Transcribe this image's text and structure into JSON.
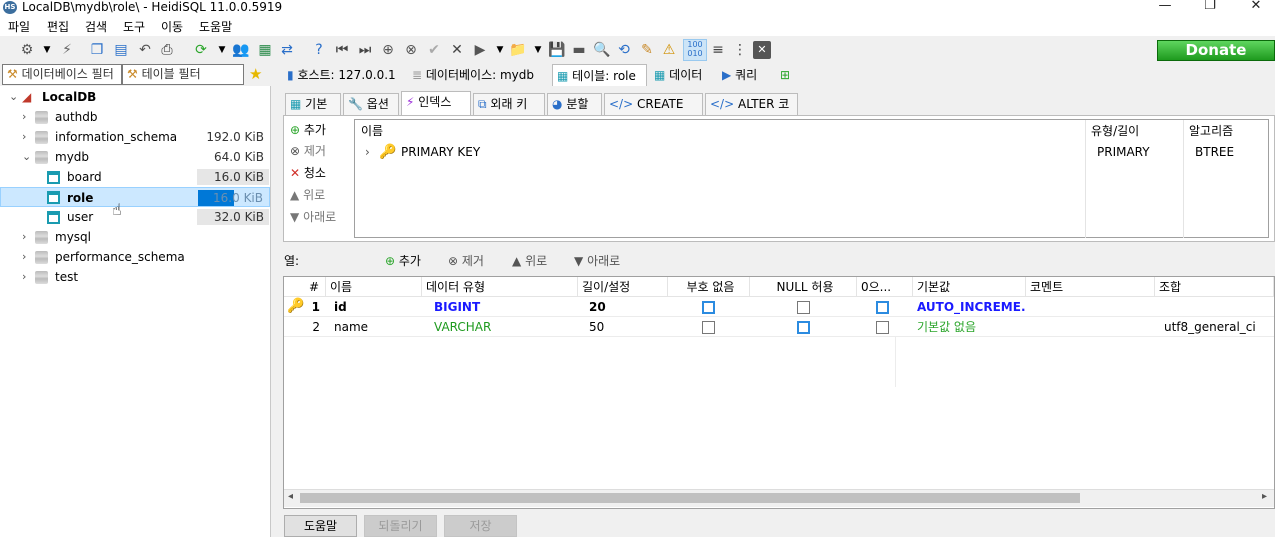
{
  "window": {
    "title": "LocalDB\\mydb\\role\\ - HeidiSQL 11.0.0.5919",
    "app_icon_text": "HS"
  },
  "menu": [
    "파일",
    "편집",
    "검색",
    "도구",
    "이동",
    "도움말"
  ],
  "donate_label": "Donate",
  "filters": {
    "db_filter": "데이터베이스 필터",
    "table_filter": "테이블 필터"
  },
  "tree": {
    "root": "LocalDB",
    "databases": [
      {
        "name": "authdb",
        "size": ""
      },
      {
        "name": "information_schema",
        "size": "192.0 KiB"
      },
      {
        "name": "mydb",
        "size": "64.0 KiB"
      },
      {
        "name": "mysql",
        "size": ""
      },
      {
        "name": "performance_schema",
        "size": ""
      },
      {
        "name": "test",
        "size": ""
      }
    ],
    "tables": [
      {
        "name": "board",
        "size": "16.0 KiB"
      },
      {
        "name": "role",
        "size": "16.0 KiB"
      },
      {
        "name": "user",
        "size": "32.0 KiB"
      }
    ]
  },
  "host_tabs": {
    "host": "호스트: 127.0.0.1",
    "database": "데이터베이스: mydb",
    "table": "테이블: role",
    "data": "데이터",
    "query": "쿼리"
  },
  "editor_tabs": [
    "기본",
    "옵션",
    "인덱스",
    "외래 키",
    "분할",
    "CREATE 코드",
    "ALTER 코드"
  ],
  "index_buttons": {
    "add": "추가",
    "remove": "제거",
    "clear": "청소",
    "up": "위로",
    "down": "아래로"
  },
  "index_list": {
    "headers": {
      "name": "이름",
      "type": "유형/길이",
      "algo": "알고리즘"
    },
    "rows": [
      {
        "name": "PRIMARY KEY",
        "type": "PRIMARY",
        "algo": "BTREE"
      }
    ]
  },
  "columns_toolbar": {
    "label": "열:",
    "add": "추가",
    "remove": "제거",
    "up": "위로",
    "down": "아래로"
  },
  "grid": {
    "headers": [
      "#",
      "이름",
      "데이터 유형",
      "길이/설정",
      "부호 없음",
      "NULL 허용",
      "0으...",
      "기본값",
      "코멘트",
      "조합"
    ],
    "rows": [
      {
        "num": "1",
        "name": "id",
        "type": "BIGINT",
        "length": "20",
        "unsigned": true,
        "nullable": false,
        "zerofill": true,
        "default": "AUTO_INCREME...",
        "comment": "",
        "collation": ""
      },
      {
        "num": "2",
        "name": "name",
        "type": "VARCHAR",
        "length": "50",
        "unsigned": false,
        "nullable": true,
        "zerofill": false,
        "default": "기본값 없음",
        "comment": "",
        "collation": "utf8_general_ci"
      }
    ]
  },
  "bottom_buttons": {
    "help": "도움말",
    "discard": "되돌리기",
    "save": "저장"
  },
  "colors": {
    "accent": "#0078d7",
    "int_type": "#1a1aff",
    "text_type": "#1e9a1e",
    "donate": "#2aa52a"
  }
}
